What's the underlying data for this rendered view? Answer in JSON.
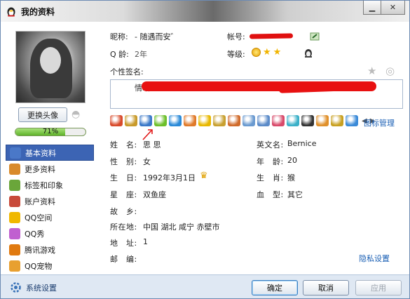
{
  "window": {
    "title": "我的资料"
  },
  "left": {
    "change_avatar_label": "更换头像",
    "progress_label": "71%",
    "progress_value": 0.71,
    "nav": [
      {
        "label": "基本资料",
        "active": true,
        "icon": "basic-info-icon",
        "color": "#4a78c8"
      },
      {
        "label": "更多资料",
        "active": false,
        "icon": "more-info-icon",
        "color": "#d98a2a"
      },
      {
        "label": "标签和印象",
        "active": false,
        "icon": "tags-icon",
        "color": "#6aa63a"
      },
      {
        "label": "账户资料",
        "active": false,
        "icon": "account-icon",
        "color": "#c84a3a"
      },
      {
        "label": "QQ空间",
        "active": false,
        "icon": "qzone-star-icon",
        "color": "#f0b800"
      },
      {
        "label": "QQ秀",
        "active": false,
        "icon": "qq-show-icon",
        "color": "#c060d0"
      },
      {
        "label": "腾讯游戏",
        "active": false,
        "icon": "tencent-games-icon",
        "color": "#e07a10"
      },
      {
        "label": "QQ宠物",
        "active": false,
        "icon": "qq-pet-icon",
        "color": "#e8a030"
      }
    ]
  },
  "header": {
    "nickname_label": "昵称:",
    "nickname_value": "- 随遇而安゛",
    "account_label": "帐号:",
    "age_label": "Q 龄:",
    "age_value": "2年",
    "level_label": "等级:",
    "signature_label": "个性签名:",
    "signature_text": "情暗"
  },
  "icons": {
    "manage_label": "图标管理"
  },
  "profile": {
    "name_label": "姓　名:",
    "name_value": "思 思",
    "english_name_label": "英文名:",
    "english_name_value": "Bernice",
    "gender_label": "性　别:",
    "gender_value": "女",
    "age_label": "年　龄:",
    "age_value": "20",
    "birthday_label": "生　日:",
    "birthday_value": "1992年3月1日",
    "zodiac_label": "生　肖:",
    "zodiac_value": "猴",
    "constellation_label": "星　座:",
    "constellation_value": "双鱼座",
    "blood_label": "血　型:",
    "blood_value": "其它",
    "hometown_label": "故　乡:",
    "hometown_value": "",
    "location_label": "所在地:",
    "location_value": "中国  湖北  咸宁  赤壁市",
    "address_label": "地　址:",
    "address_value": "1",
    "postcode_label": "邮　编:",
    "postcode_value": "",
    "privacy_label": "隐私设置"
  },
  "footer": {
    "settings_label": "系统设置",
    "ok_label": "确定",
    "cancel_label": "取消",
    "apply_label": "应用"
  }
}
